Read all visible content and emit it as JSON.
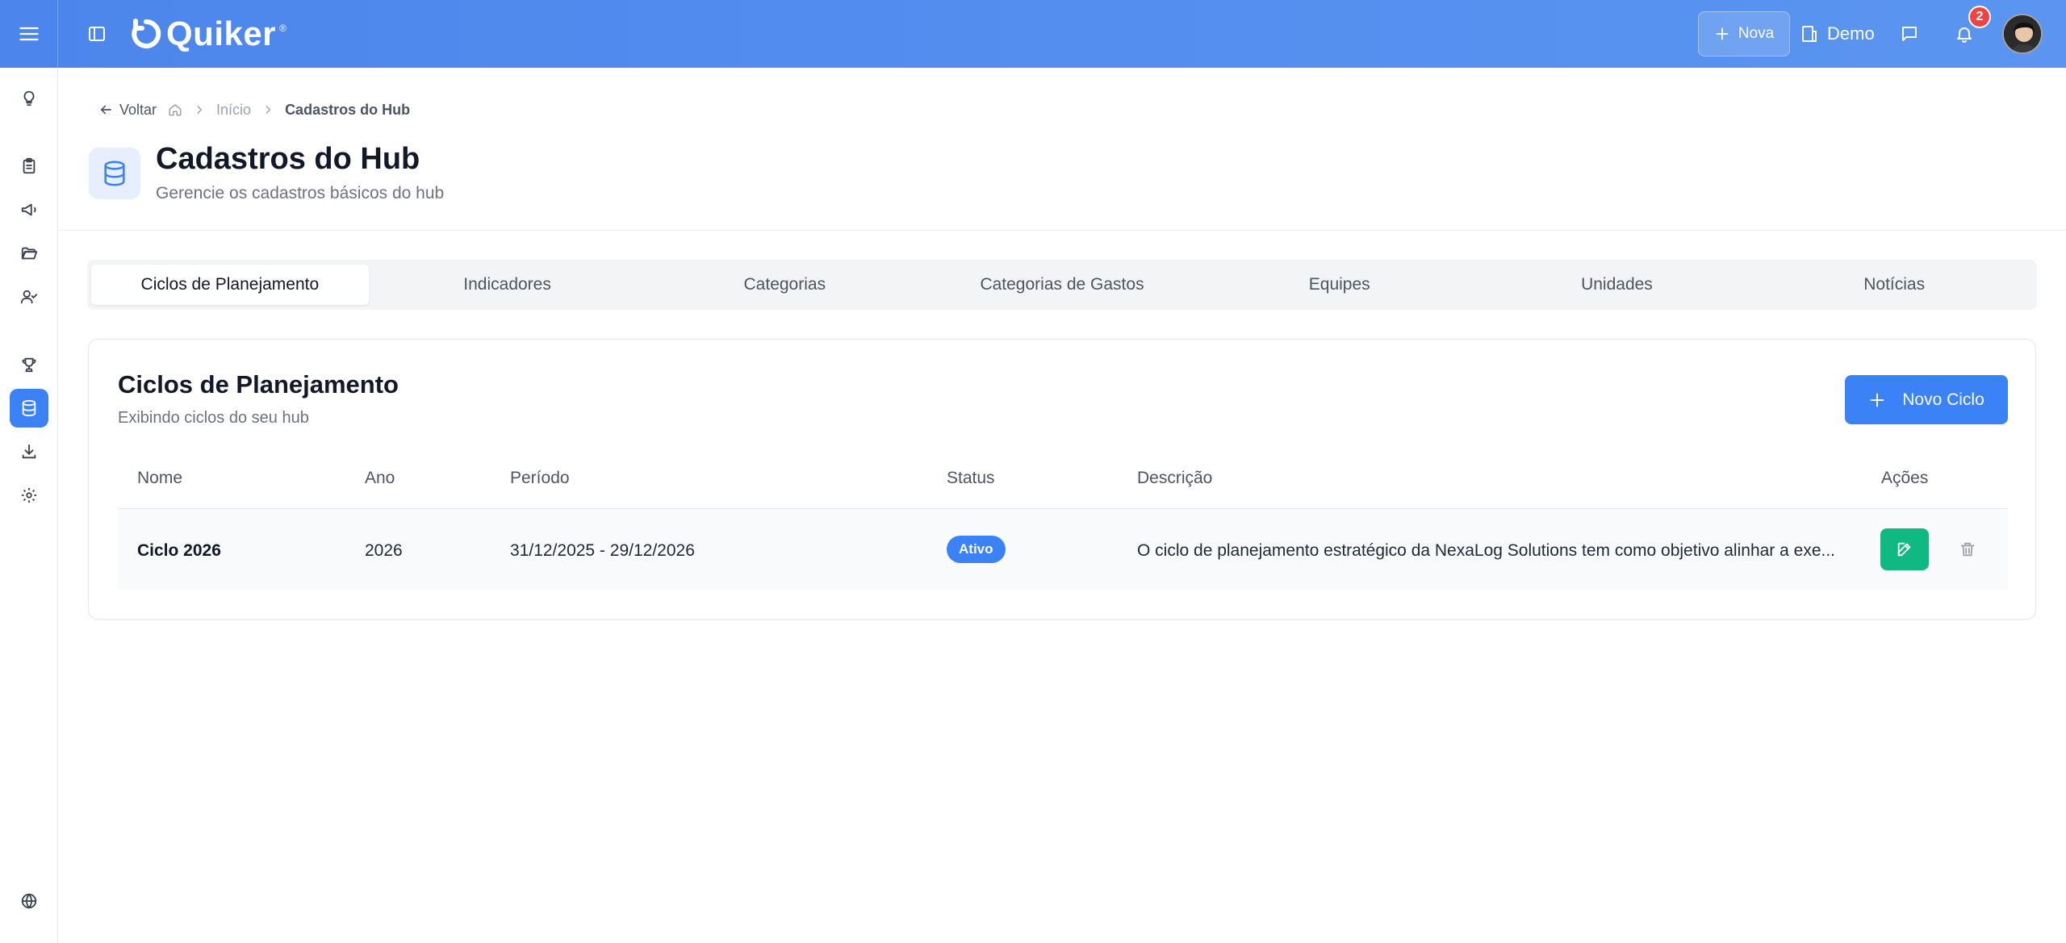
{
  "app": {
    "logo_text": "Quiker",
    "logo_mark": "®"
  },
  "topbar": {
    "new_label": "Nova",
    "workspace_label": "Demo",
    "notification_count": "2"
  },
  "breadcrumb": {
    "back_label": "Voltar",
    "home_label": "Início",
    "current_label": "Cadastros do Hub"
  },
  "page": {
    "title": "Cadastros do Hub",
    "subtitle": "Gerencie os cadastros básicos do hub"
  },
  "tabs": [
    {
      "label": "Ciclos de Planejamento",
      "active": true
    },
    {
      "label": "Indicadores",
      "active": false
    },
    {
      "label": "Categorias",
      "active": false
    },
    {
      "label": "Categorias de Gastos",
      "active": false
    },
    {
      "label": "Equipes",
      "active": false
    },
    {
      "label": "Unidades",
      "active": false
    },
    {
      "label": "Notícias",
      "active": false
    }
  ],
  "card": {
    "title": "Ciclos de Planejamento",
    "subtitle": "Exibindo ciclos do seu hub",
    "new_button_label": "Novo Ciclo"
  },
  "table": {
    "columns": [
      "Nome",
      "Ano",
      "Período",
      "Status",
      "Descrição",
      "Ações"
    ],
    "rows": [
      {
        "name": "Ciclo 2026",
        "year": "2026",
        "period": "31/12/2025 - 29/12/2026",
        "status": "Ativo",
        "description": "O ciclo de planejamento estratégico da NexaLog Solutions tem como objetivo alinhar a exe..."
      }
    ]
  },
  "colors": {
    "primary": "#3b82f6",
    "topbar": "#4c86ec",
    "success": "#10b981",
    "danger": "#ef4444"
  }
}
